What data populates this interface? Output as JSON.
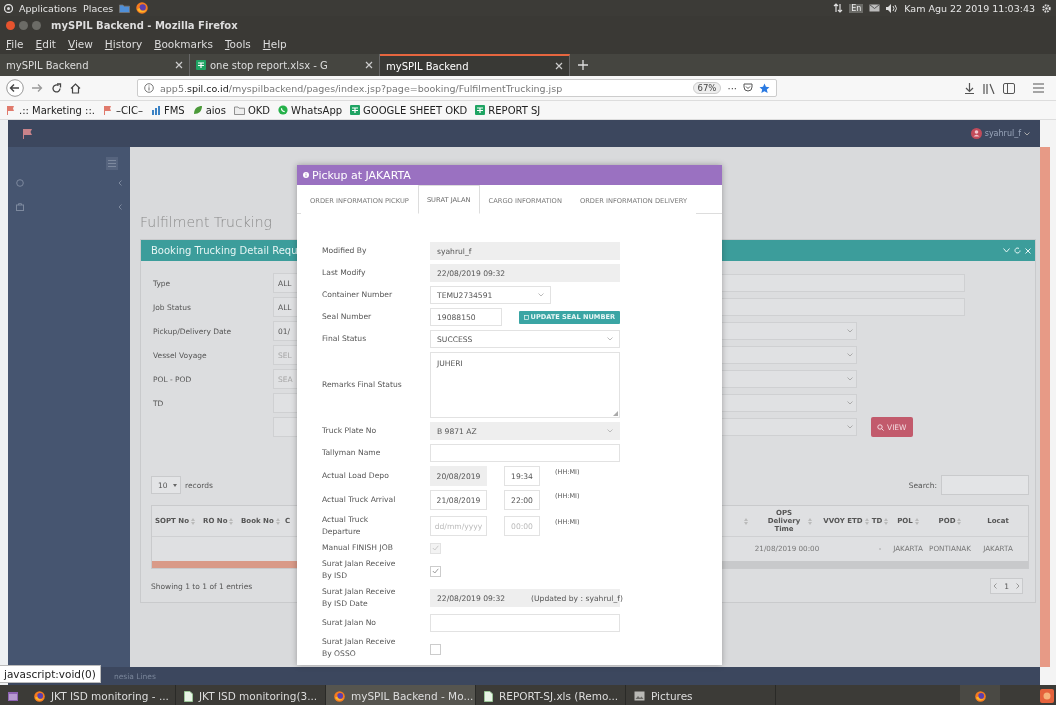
{
  "system_bar": {
    "menus": [
      "Applications",
      "Places"
    ],
    "keyboard": "En",
    "clock": "Kam Agu 22 2019 11:03:43"
  },
  "window": {
    "title": "mySPIL Backend - Mozilla Firefox"
  },
  "menu_bar": [
    "File",
    "Edit",
    "View",
    "History",
    "Bookmarks",
    "Tools",
    "Help"
  ],
  "tabs": [
    {
      "label": "mySPIL Backend",
      "kind": "page",
      "selected": false
    },
    {
      "label": "one stop report.xlsx - G",
      "kind": "sheet",
      "selected": false
    },
    {
      "label": "mySPIL Backend",
      "kind": "page",
      "selected": true
    }
  ],
  "address_bar": {
    "url": "app5.**spil.co.id**/myspilbackend/pages/index.jsp?page=booking/FulfilmentTrucking.jsp",
    "zoom": "67%",
    "more": "···"
  },
  "bookmarks": [
    {
      "label": ".:: Marketing ::.",
      "kind": "flag"
    },
    {
      "label": "–CIC–",
      "kind": "flag"
    },
    {
      "label": "FMS",
      "kind": "chart"
    },
    {
      "label": "aios",
      "kind": "leaf"
    },
    {
      "label": "OKD",
      "kind": "folder"
    },
    {
      "label": "WhatsApp",
      "kind": "whatsapp"
    },
    {
      "label": "GOOGLE SHEET OKD",
      "kind": "sheet"
    },
    {
      "label": "REPORT SJ",
      "kind": "sheet"
    }
  ],
  "app": {
    "user": "syahrul_f",
    "page_title": "Fulfilment Trucking",
    "panel_title": "Booking Trucking Detail Requ",
    "filters": [
      {
        "label": "Type",
        "value": "ALL",
        "kind": "text"
      },
      {
        "label": "Job Status",
        "value": "ALL",
        "kind": "text"
      },
      {
        "label": "Pickup/Delivery Date",
        "value": "01/",
        "kind": "select"
      },
      {
        "label": "Vessel Voyage",
        "placeholder": "SEL",
        "kind": "select"
      },
      {
        "label": "POL - POD",
        "placeholder": "SEA",
        "kind": "select"
      },
      {
        "label": "TD",
        "kind": "select"
      },
      {
        "kind": "select",
        "button": "VIEW"
      }
    ],
    "page_length": "10",
    "records_label": "records",
    "search_label": "Search:",
    "left_columns": [
      "SOPT No",
      "RO No",
      "Book No",
      "C"
    ],
    "right_columns": [
      {
        "label": "OPS Delivery Time",
        "cell": "21/08/2019 00:00"
      },
      {
        "label": "VVOY ETD"
      },
      {
        "label": "TD",
        "cell": "-"
      },
      {
        "label": "POL",
        "cell": "JAKARTA"
      },
      {
        "label": "POD",
        "cell": "PONTIANAK"
      },
      {
        "label": "Locat",
        "cell": "JAKARTA"
      }
    ],
    "info": "Showing 1 to 1 of 1 entries",
    "page": "1",
    "footer": "nesia Lines"
  },
  "modal": {
    "title": "Pickup at JAKARTA",
    "tabs": [
      {
        "label": "ORDER INFORMATION PICKUP",
        "selected": false
      },
      {
        "label": "SURAT JALAN",
        "selected": true
      },
      {
        "label": "CARGO INFORMATION",
        "selected": false
      },
      {
        "label": "ORDER INFORMATION DELIVERY",
        "selected": false
      }
    ],
    "fields": [
      {
        "label": "Modified By",
        "kind": "text",
        "value": "syahrul_f",
        "readonly": true
      },
      {
        "label": "Last Modify",
        "kind": "text",
        "value": "22/08/2019 09:32",
        "readonly": true
      },
      {
        "label": "Container Number",
        "kind": "short_select",
        "value": "TEMU2734591",
        "readonly": false
      },
      {
        "label": "Seal Number",
        "kind": "short_text",
        "value": "19088150",
        "readonly": false,
        "button": "UPDATE SEAL NUMBER"
      },
      {
        "label": "Final Status",
        "kind": "select",
        "value": "SUCCESS",
        "readonly": false
      },
      {
        "label": "Remarks Final Status",
        "kind": "textarea",
        "value": "JUHERI"
      },
      {
        "label": "Truck Plate No",
        "kind": "select",
        "value": "B 9871 AZ",
        "readonly": true
      },
      {
        "label": "Tallyman Name",
        "kind": "text",
        "readonly": false
      },
      {
        "label": "Actual Load Depo",
        "kind": "datetime",
        "date": "20/08/2019",
        "time": "19:34",
        "date_readonly": true,
        "unit": "(HH:MI)"
      },
      {
        "label": "Actual Truck Arrival",
        "kind": "datetime",
        "date": "21/08/2019",
        "time": "22:00",
        "date_readonly": false,
        "unit": "(HH:MI)"
      },
      {
        "label": "Actual Truck Departure",
        "kind": "datetime",
        "date_placeholder": "dd/mm/yyyy",
        "time_placeholder": "00:00",
        "date_readonly": false,
        "unit": "(HH:MI)"
      },
      {
        "label": "Manual FINISH JOB",
        "kind": "checkbox",
        "checked": true,
        "disabled": true
      },
      {
        "label": "Surat Jalan Receive By ISD",
        "kind": "checkbox",
        "checked": true,
        "disabled": false
      },
      {
        "label": "Surat Jalan Receive By ISD Date",
        "kind": "info",
        "value": "22/08/2019 09:32",
        "note": "(Updated by : syahrul_f)"
      },
      {
        "label": "Surat Jalan No",
        "kind": "text",
        "readonly": false
      },
      {
        "label": "Surat Jalan Receive By OSSO",
        "kind": "checkbox",
        "checked": false,
        "disabled": false
      }
    ]
  },
  "status_text": "javascript:void(0)",
  "taskbar": [
    {
      "label": "JKT ISD monitoring - ...",
      "kind": "firefox",
      "selected": false
    },
    {
      "label": "JKT ISD monitoring(3...",
      "kind": "document",
      "selected": false
    },
    {
      "label": "mySPIL Backend - Mo...",
      "kind": "firefox",
      "selected": true
    },
    {
      "label": "REPORT-SJ.xls (Remo...",
      "kind": "document",
      "selected": false
    },
    {
      "label": "Pictures",
      "kind": "folder",
      "selected": false
    }
  ]
}
